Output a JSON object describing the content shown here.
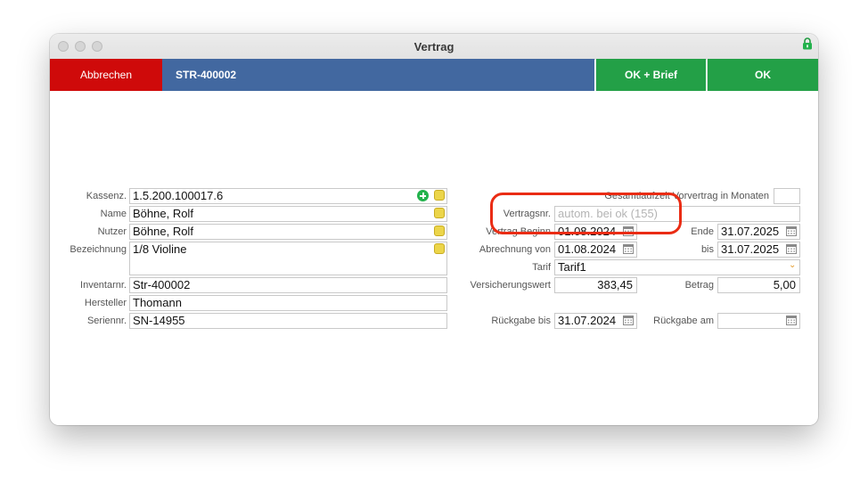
{
  "window": {
    "title": "Vertrag"
  },
  "toolbar": {
    "cancel_label": "Abbrechen",
    "contract_id": "STR-400002",
    "ok_brief_label": "OK + Brief",
    "ok_label": "OK"
  },
  "left": {
    "kassenz_label": "Kassenz.",
    "kassenz_value": "1.5.200.100017.6",
    "name_label": "Name",
    "name_value": "Böhne, Rolf",
    "nutzer_label": "Nutzer",
    "nutzer_value": "Böhne, Rolf",
    "bezeichnung_label": "Bezeichnung",
    "bezeichnung_value": "1/8 Violine",
    "inventarnr_label": "Inventarnr.",
    "inventarnr_value": "Str-400002",
    "hersteller_label": "Hersteller",
    "hersteller_value": "Thomann",
    "seriennr_label": "Seriennr.",
    "seriennr_value": "SN-14955"
  },
  "right": {
    "gesamtlaufzeit_label": "Gesamtlaufzeit Vorvertrag in Monaten",
    "gesamtlaufzeit_value": "",
    "vertragsnr_label": "Vertragsnr.",
    "vertragsnr_placeholder": "autom. bei ok (155)",
    "beginn_label": "Vertrag Beginn",
    "beginn_value": "01.08.2024",
    "ende_label": "Ende",
    "ende_value": "31.07.2025",
    "abrechnung_label": "Abrechnung von",
    "abrechnung_value": "01.08.2024",
    "bis_label": "bis",
    "bis_value": "31.07.2025",
    "tarif_label": "Tarif",
    "tarif_value": "Tarif1",
    "versicherungswert_label": "Versicherungswert",
    "versicherungswert_value": "383,45",
    "betrag_label": "Betrag",
    "betrag_value": "5,00",
    "rueckgabe_bis_label": "Rückgabe bis",
    "rueckgabe_bis_value": "31.07.2024",
    "rueckgabe_am_label": "Rückgabe am",
    "rueckgabe_am_value": ""
  },
  "colors": {
    "cancel": "#cf0a0a",
    "contract_bar": "#4268a0",
    "ok": "#23a047",
    "highlight": "#ea2c14"
  }
}
